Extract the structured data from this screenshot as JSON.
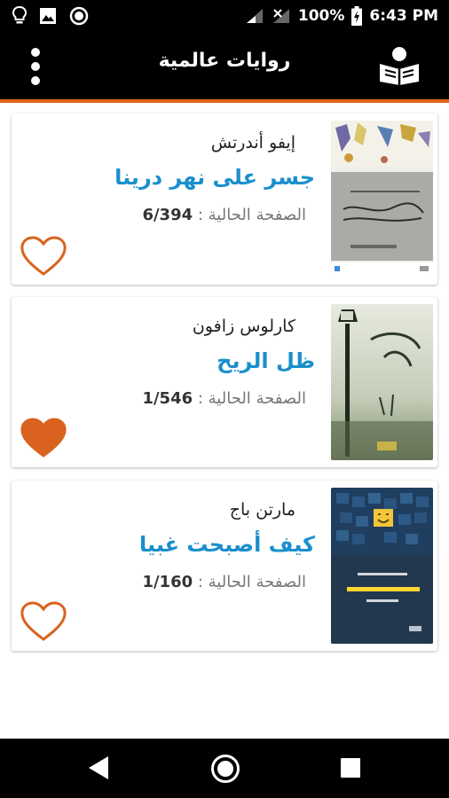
{
  "status_bar": {
    "battery": "100%",
    "time": "6:43 PM",
    "icons": [
      "lightbulb-icon",
      "image-icon",
      "record-icon",
      "signal-icon",
      "no-signal-icon",
      "battery-charging-icon"
    ]
  },
  "app_bar": {
    "title": "روايات عالمية",
    "left_icon": "more-vert-icon",
    "right_icon": "reader-book-icon",
    "accent_color": "#e0661a"
  },
  "page_label": "الصفحة الحالية :",
  "books": [
    {
      "author": "إيفو أندرتش",
      "title": "جسر على نهر درينا",
      "page": "6/394",
      "favorite": false,
      "heart_color": "#d9631e"
    },
    {
      "author": "كارلوس زافون",
      "title": "ظل الريح",
      "page": "1/546",
      "favorite": true,
      "heart_color": "#d9631e"
    },
    {
      "author": "مارتن باج",
      "title": "كيف أصبحت غبيا",
      "page": "1/160",
      "favorite": false,
      "heart_color": "#d9631e"
    }
  ],
  "nav_bar": {
    "icons": [
      "back-triangle-icon",
      "home-circle-icon",
      "recents-square-icon"
    ]
  },
  "colors": {
    "title_blue": "#1a8fcc",
    "bars": "#000000"
  }
}
